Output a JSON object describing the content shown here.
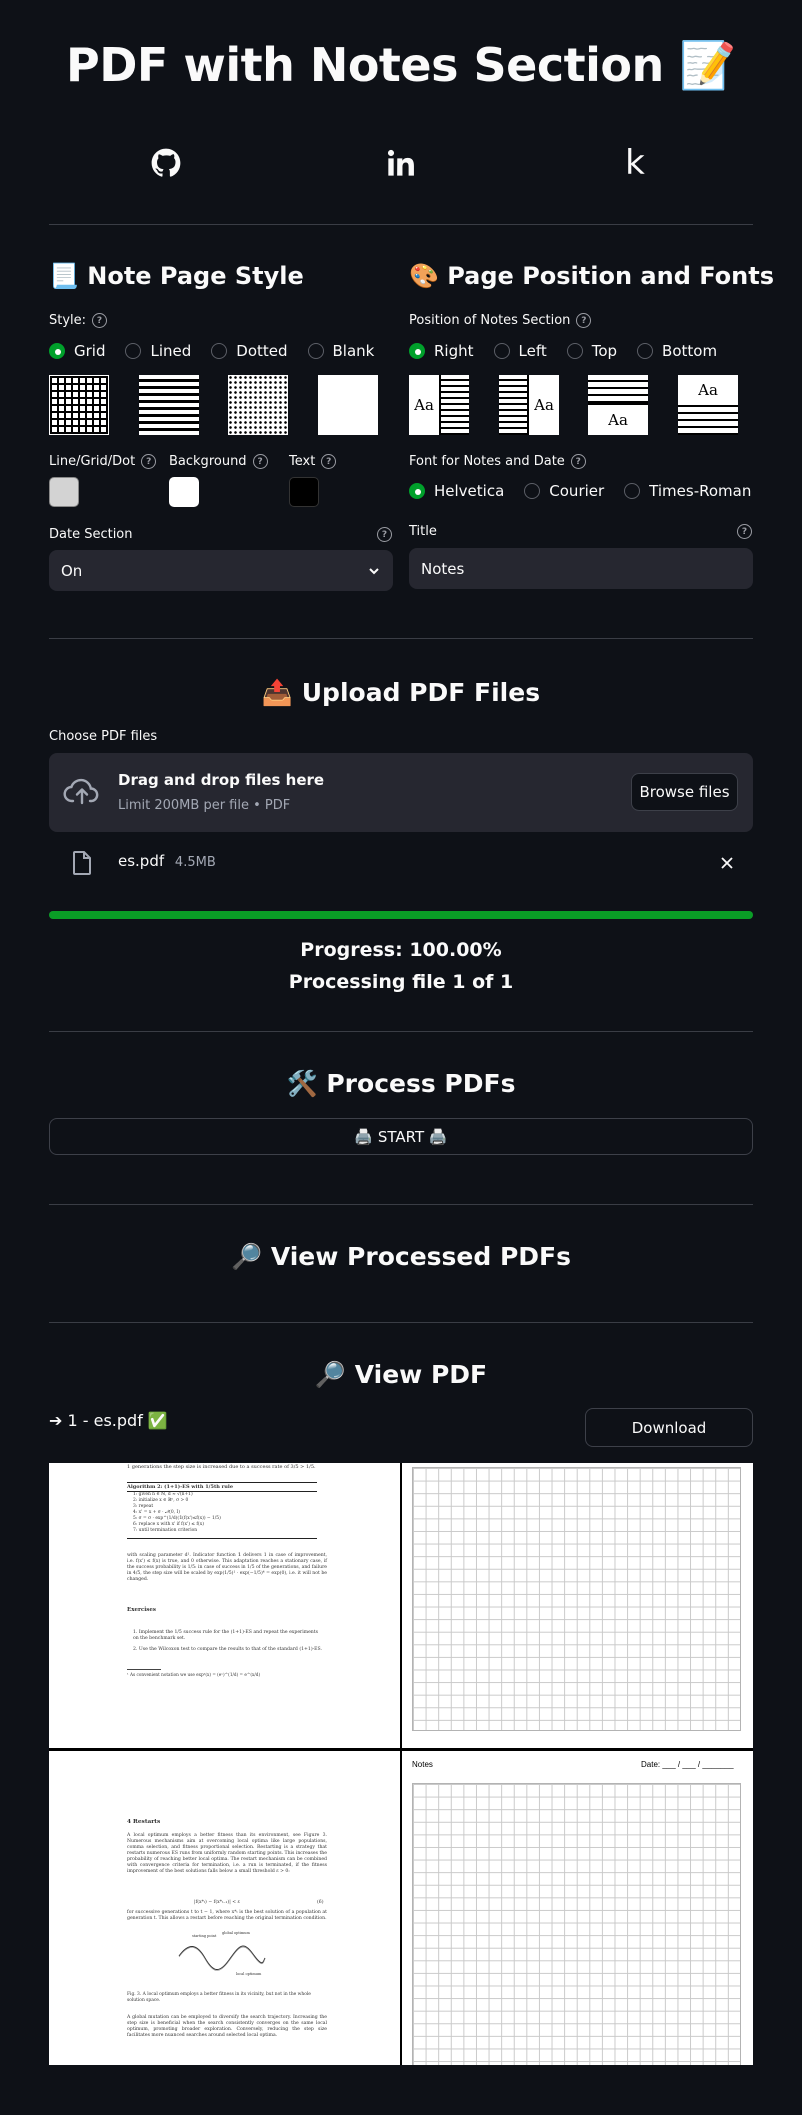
{
  "header": {
    "title": "PDF with Notes Section 📝"
  },
  "social": {
    "github_icon": "github-icon",
    "linkedin_icon": "linkedin-icon",
    "kaggle_icon": "kaggle-icon",
    "kaggle_glyph": "k"
  },
  "note_style": {
    "heading": "📃 Note Page Style",
    "style_label": "Style:",
    "options": [
      "Grid",
      "Lined",
      "Dotted",
      "Blank"
    ],
    "selected": "Grid",
    "line_label": "Line/Grid/Dot",
    "background_label": "Background",
    "text_label": "Text",
    "colors": {
      "line": "#d3d3d3",
      "background": "#ffffff",
      "text": "#000000"
    },
    "date_label": "Date Section",
    "date_value": "On"
  },
  "position_fonts": {
    "heading": "🎨 Page Position and Fonts",
    "position_label": "Position of Notes Section",
    "positions": [
      "Right",
      "Left",
      "Top",
      "Bottom"
    ],
    "selected_position": "Right",
    "thumb_text": "Aa",
    "font_label": "Font for Notes and Date",
    "fonts": [
      "Helvetica",
      "Courier",
      "Times-Roman"
    ],
    "selected_font": "Helvetica",
    "title_label": "Title",
    "title_value": "Notes"
  },
  "upload": {
    "heading": "📤 Upload PDF Files",
    "choose_label": "Choose PDF files",
    "drag_text": "Drag and drop files here",
    "limit_text": "Limit 200MB per file • PDF",
    "browse_label": "Browse files",
    "file_name": "es.pdf",
    "file_size": "4.5MB",
    "progress_fraction": 1.0,
    "progress_text": "Progress: 100.00%",
    "processing_text": "Processing file 1 of 1"
  },
  "process": {
    "heading": "🛠️ Process PDFs",
    "start_label": "🖨️ START 🖨️"
  },
  "view_processed": {
    "heading": "🔎 View Processed PDFs"
  },
  "view_pdf": {
    "heading": "🔎 View PDF",
    "file_label": "➔ 1 - es.pdf ✅",
    "download_label": "Download",
    "notes_title": "Notes",
    "date_text": "Date: ___ / ___ / _______",
    "page1": {
      "top_line": "1 generations the step size is increased due to a success rate of 3/5 > 1/5.",
      "algo_title": "Algorithm 2: (1+1)-ES with 1/5th rule",
      "algo_lines": [
        "1: given n ∈ ℕ, d ≈ √(n+1)",
        "2: initialize x ∈ ℝⁿ, σ > 0",
        "3: repeat",
        "4:   x' = x + σ · 𝒩(0, I)",
        "5:   σ = σ · exp^(1/d)(𝟙(f(x')≤f(x)) − 1/5)",
        "6:   replace x with x' if f(x') ≤ f(x)",
        "7: until termination criterion"
      ],
      "body": "with scaling parameter d¹. Indicator function 𝟙 delivers 1 in case of improvement, i.e. f(x') ≤ f(x) is true, and 0 otherwise. This adaptation reaches a stationary case, if the success probability is 1/5: in case of success in 1/5 of the generations, and failure in 4/5, the step size will be scaled by exp(1/5)¹ · exp(−1/5)⁴ = exp(0), i.e. it will not be changed.",
      "exercises_title": "Exercises",
      "exercises": [
        "1. Implement the 1/5 success rule for the (1+1)-ES and repeat the experiments on the benchmark set.",
        "2. Use the Wilcoxon test to compare the results to that of the standard (1+1)-ES."
      ],
      "footnote": "¹ As convenient notation we use expᵈ(x) = (eˣ)^(1/d) = e^(x/d)"
    },
    "page2": {
      "section_title": "4   Restarts",
      "body1": "A local optimum employs a better fitness than its environment, see Figure 3. Numerous mechanisms aim at overcoming local optima like large populations, comma selection, and fitness proportional selection. Restarting is a strategy that restarts numerous ES runs from uniformly random starting points. This increases the probability of reaching better local optima. The restart mechanism can be combined with convergence criteria for termination, i.e. a run is terminated, if the fitness improvement of the best solutions falls below a small threshold ε > 0:",
      "equation": "|f(x*ₜ) − f(x*ₜ₋₁)| < ε",
      "equation_number": "(6)",
      "body2": "for successive generations t to t − 1, where x*ₜ is the best solution of a population at generation t. This allows a restart before reaching the original termination condition.",
      "curve_label_start": "starting point",
      "curve_label_global": "global optimum",
      "curve_label_local": "local optimum",
      "fig_caption": "Fig. 3. A local optimum employs a better fitness in its vicinity, but not in the whole solution space.",
      "body3": "A global mutation can be employed to diversify the search trajectory. Increasing the step size is beneficial when the search consistently converges on the same local optimum, promoting broader exploration. Conversely, reducing the step size facilitates more nuanced searches around selected local optima."
    }
  }
}
